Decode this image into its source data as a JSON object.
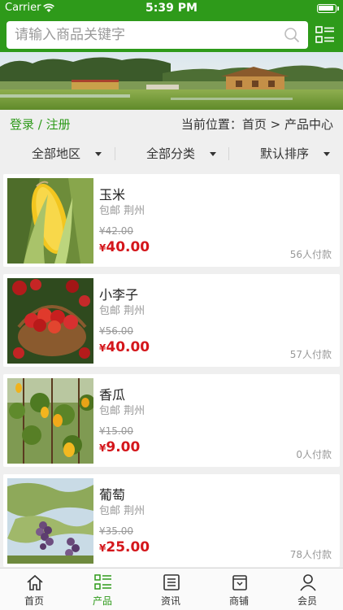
{
  "status": {
    "carrier": "Carrier",
    "time": "5:39 PM"
  },
  "search": {
    "placeholder": "请输入商品关键字"
  },
  "account": {
    "login": "登录",
    "sep": "/",
    "register": "注册"
  },
  "breadcrumb": {
    "text": "当前位置：首页 > 产品中心"
  },
  "filters": [
    {
      "label": "全部地区"
    },
    {
      "label": "全部分类"
    },
    {
      "label": "默认排序"
    }
  ],
  "products": [
    {
      "name": "玉米",
      "ship": "包邮 荆州",
      "old_price": "¥42.00",
      "currency": "¥",
      "price": "40.00",
      "sold": "56人付款",
      "image": "corn"
    },
    {
      "name": "小李子",
      "ship": "包邮 荆州",
      "old_price": "¥56.00",
      "currency": "¥",
      "price": "40.00",
      "sold": "57人付款",
      "image": "plums"
    },
    {
      "name": "香瓜",
      "ship": "包邮 荆州",
      "old_price": "¥15.00",
      "currency": "¥",
      "price": "9.00",
      "sold": "0人付款",
      "image": "melons"
    },
    {
      "name": "葡萄",
      "ship": "包邮 荆州",
      "old_price": "¥35.00",
      "currency": "¥",
      "price": "25.00",
      "sold": "78人付款",
      "image": "grapes"
    }
  ],
  "tabs": [
    {
      "label": "首页",
      "icon": "home-icon",
      "active": false
    },
    {
      "label": "产品",
      "icon": "grid-list-icon",
      "active": true
    },
    {
      "label": "资讯",
      "icon": "news-icon",
      "active": false
    },
    {
      "label": "商铺",
      "icon": "shop-icon",
      "active": false
    },
    {
      "label": "会员",
      "icon": "user-icon",
      "active": false
    }
  ],
  "colors": {
    "brand": "#2e9a1a",
    "price": "#d4161b"
  }
}
